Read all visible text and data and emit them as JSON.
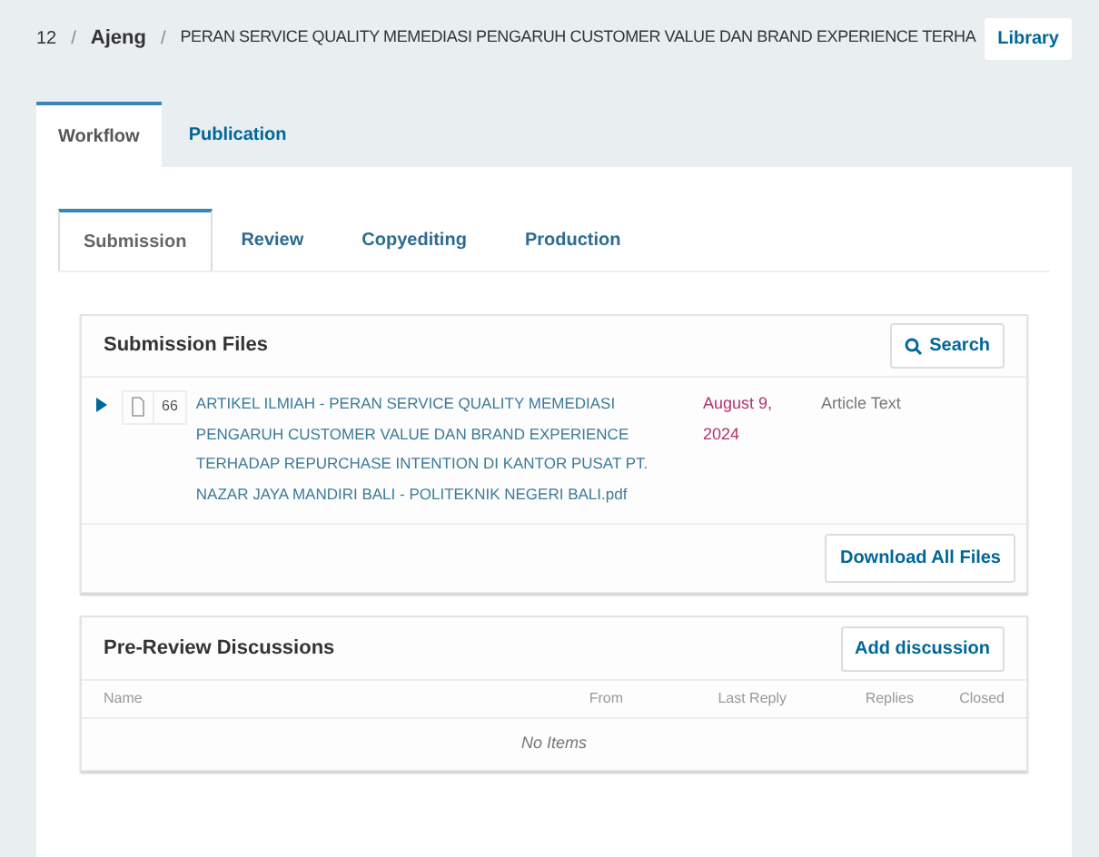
{
  "breadcrumb": {
    "id": "12",
    "separator_1": "/",
    "author": "Ajeng",
    "separator_2": "/",
    "title": "PERAN SERVICE QUALITY MEMEDIASI PENGARUH CUSTOMER VALUE DAN BRAND EXPERIENCE TERHA",
    "library_button": "Library"
  },
  "tabs": [
    {
      "label": "Workflow",
      "selected": true
    },
    {
      "label": "Publication",
      "selected": false
    }
  ],
  "stage_tabs": [
    {
      "label": "Submission",
      "selected": true
    },
    {
      "label": "Review",
      "selected": false
    },
    {
      "label": "Copyediting",
      "selected": false
    },
    {
      "label": "Production",
      "selected": false
    }
  ],
  "submission_files": {
    "title": "Submission Files",
    "search_button": "Search",
    "files": [
      {
        "id": "66",
        "name": "ARTIKEL ILMIAH - PERAN SERVICE QUALITY MEMEDIASI PENGARUH CUSTOMER VALUE DAN BRAND EXPERIENCE TERHADAP REPURCHASE INTENTION DI KANTOR PUSAT PT. NAZAR JAYA MANDIRI BALI - POLITEKNIK NEGERI BALI.pdf",
        "date": "August 9, 2024",
        "type": "Article Text",
        "expanded": false
      }
    ],
    "download_button": "Download All Files"
  },
  "discussions": {
    "title": "Pre-Review Discussions",
    "add_button": "Add discussion",
    "columns": [
      "Name",
      "From",
      "Last Reply",
      "Replies",
      "Closed"
    ],
    "empty": "No Items"
  }
}
